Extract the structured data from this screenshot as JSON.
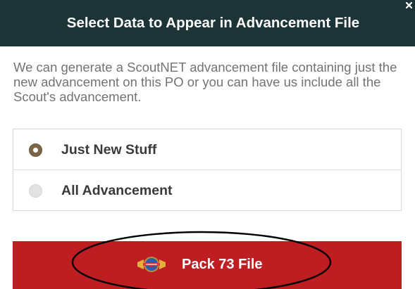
{
  "dialog": {
    "title": "Select Data to Appear in Advancement File",
    "close_symbol": "×",
    "description": "We can generate a ScoutNET advancement file containing just the new advancement on this PO or you can have us include all the Scout's advancement."
  },
  "options": [
    {
      "label": "Just New Stuff",
      "selected": true
    },
    {
      "label": "All Advancement",
      "selected": false
    }
  ],
  "file_button": {
    "icon": "scoutnet-logo-icon",
    "label": "Pack 73 File"
  },
  "colors": {
    "header": "#1d3437",
    "accent_red": "#be1e22",
    "radio_selected": "#7d6549",
    "text_muted": "#737373",
    "text_dark": "#3a3a3a"
  }
}
